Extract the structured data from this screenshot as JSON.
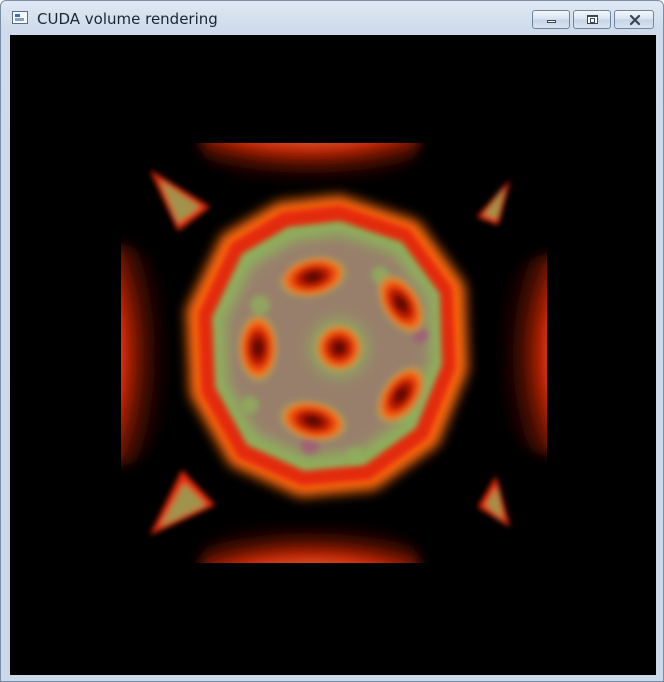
{
  "window": {
    "title": "CUDA volume rendering",
    "icon": "app-window-icon",
    "buttons": {
      "minimize": "minimize-icon",
      "maximize": "maximize-icon",
      "close": "close-icon"
    }
  },
  "render": {
    "background": "#000000",
    "palette": {
      "hot": "#e32a08",
      "warm": "#ff7b12",
      "mid": "#8fae5c",
      "cool": "#2f8f86",
      "mauve": "#a05a78"
    }
  }
}
